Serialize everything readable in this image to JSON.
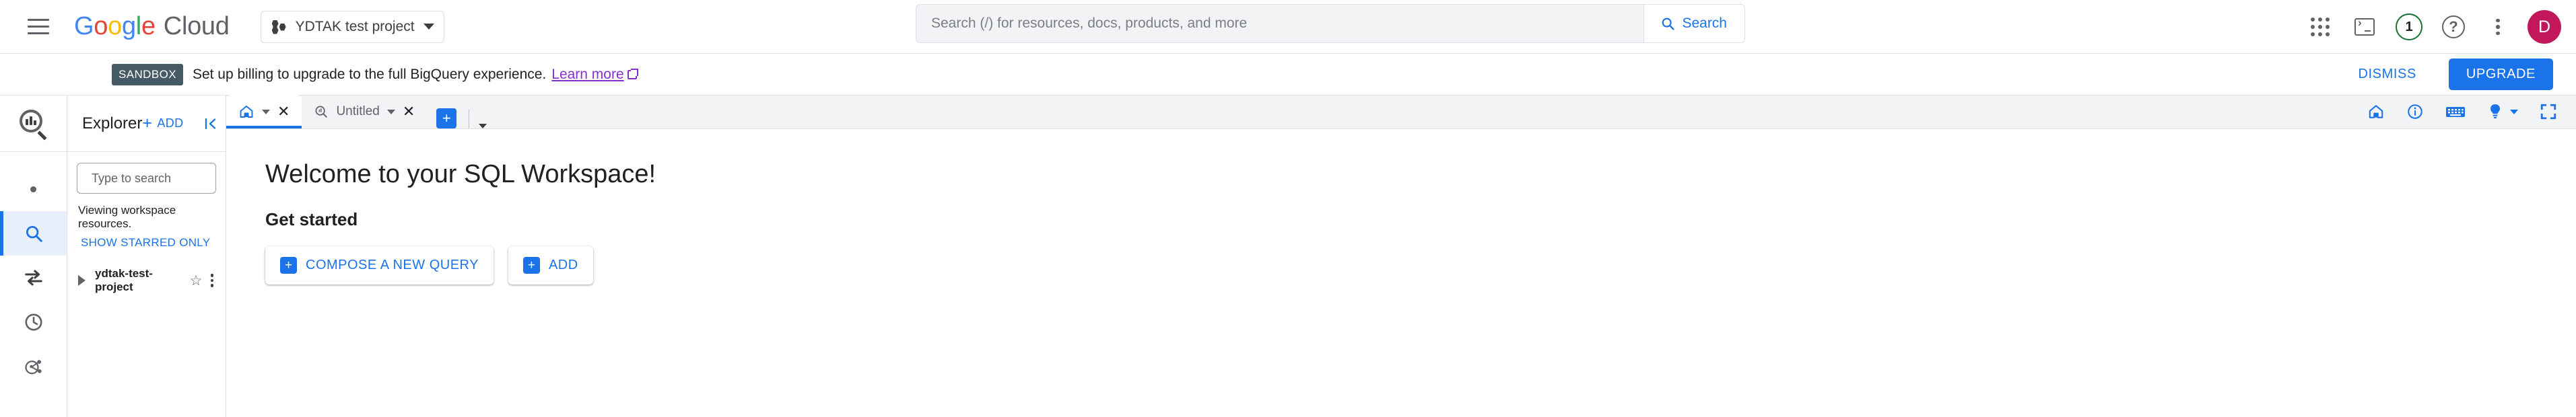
{
  "header": {
    "menu_icon": "hamburger-icon",
    "logo": {
      "google": "Google",
      "cloud": "Cloud"
    },
    "project_selector": {
      "label": "YDTAK test project",
      "icon": "project-hexagons-icon"
    },
    "search": {
      "placeholder": "Search (/) for resources, docs, products, and more",
      "value": "",
      "button_label": "Search",
      "button_icon": "search-icon"
    },
    "actions": [
      {
        "name": "apps-grid-icon",
        "label": ""
      },
      {
        "name": "cloud-shell-icon",
        "label": ""
      },
      {
        "name": "notifications-icon",
        "label": "1"
      },
      {
        "name": "help-icon",
        "label": "?"
      },
      {
        "name": "more-options-icon",
        "label": ""
      }
    ],
    "avatar": {
      "initial": "D",
      "color": "#C2185B"
    }
  },
  "banner": {
    "badge": "SANDBOX",
    "message": "Set up billing to upgrade to the full BigQuery experience.",
    "link": "Learn more",
    "link_color": "#8430ce",
    "badge_color": "#455A64",
    "dismiss_label": "DISMISS",
    "upgrade_label": "UPGRADE",
    "upgrade_color": "#1a73e8"
  },
  "rail": {
    "logo_icon": "bigquery-logo-icon",
    "items": [
      {
        "name": "rail-item-dot",
        "icon": "dot-icon",
        "active": false
      },
      {
        "name": "rail-item-search",
        "icon": "search-icon",
        "active": true
      },
      {
        "name": "rail-item-transfers",
        "icon": "transfers-arrows-icon",
        "active": false
      },
      {
        "name": "rail-item-scheduled-queries",
        "icon": "clock-icon",
        "active": false
      },
      {
        "name": "rail-item-analytics-hub",
        "icon": "share-network-icon",
        "active": false
      }
    ]
  },
  "explorer": {
    "title": "Explorer",
    "add_label": "ADD",
    "add_icon": "plus-icon",
    "collapse_icon": "collapse-panel-icon",
    "search": {
      "placeholder": "Type to search",
      "value": "",
      "icon": "search-icon",
      "help_icon": "help-circle-icon"
    },
    "note": "Viewing workspace resources.",
    "starred_label": "SHOW STARRED ONLY",
    "tree": [
      {
        "label": "ydtak-test-project",
        "expand_icon": "triangle-right-icon",
        "star_icon": "star-outline-icon",
        "menu_icon": "kebab-menu-icon"
      }
    ]
  },
  "workspace": {
    "tabs": [
      {
        "name": "tab-home",
        "icon": "home-icon",
        "label": "",
        "active": true,
        "has_caret": true,
        "has_close": true
      },
      {
        "name": "tab-untitled",
        "icon": "bigquery-query-icon",
        "label": "Untitled",
        "active": false,
        "has_caret": true,
        "has_close": true
      }
    ],
    "new_tab_icon": "plus-icon",
    "new_tab_caret_icon": "chevron-down-icon",
    "toolbar_icons": [
      {
        "name": "home-icon"
      },
      {
        "name": "info-icon"
      },
      {
        "name": "keyboard-shortcuts-icon"
      },
      {
        "name": "lightbulb-icon",
        "has_caret": true
      },
      {
        "name": "fullscreen-icon"
      }
    ],
    "welcome_title": "Welcome to your SQL Workspace!",
    "get_started_title": "Get started",
    "cards": [
      {
        "name": "compose-new-query-card",
        "label": "COMPOSE A NEW QUERY",
        "icon": "plus-square-icon"
      },
      {
        "name": "add-data-card",
        "label": "ADD",
        "icon": "plus-square-icon"
      }
    ]
  },
  "colors": {
    "accent": "#1a73e8",
    "active_rail_bg": "#e8f0fe",
    "tabbar_bg": "#f1f3f4"
  }
}
